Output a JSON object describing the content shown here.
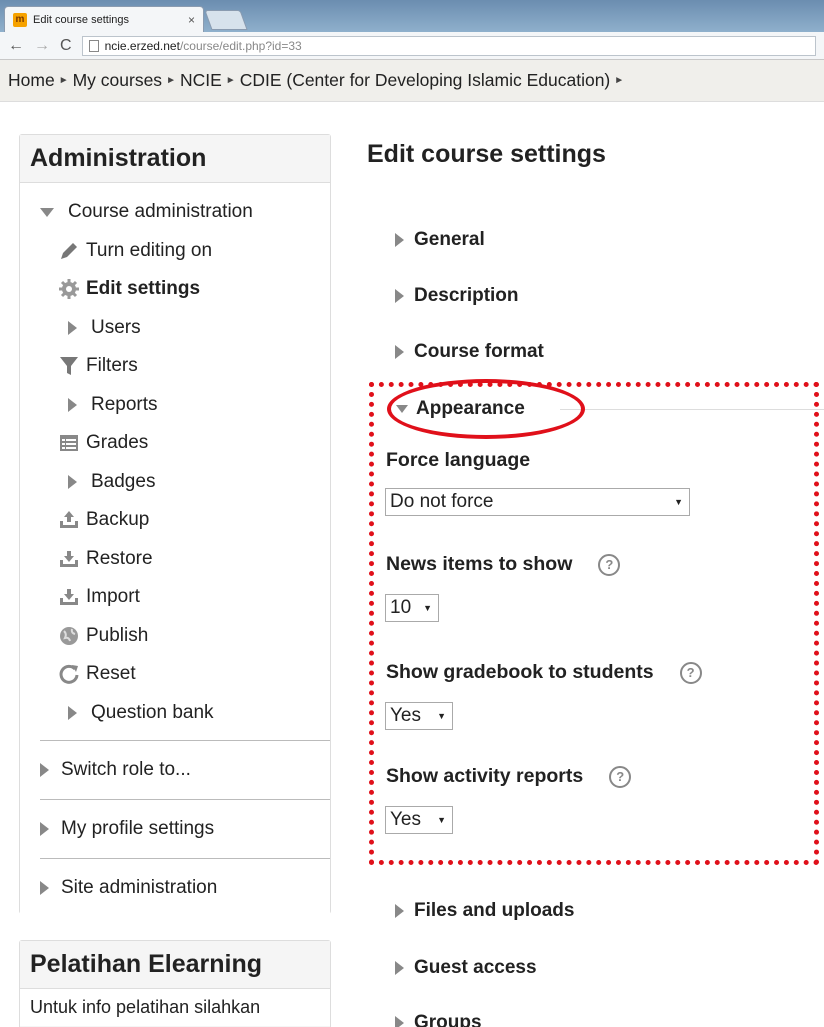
{
  "browser": {
    "tab_title": "Edit course settings",
    "tab_close": "×",
    "favicon": "m",
    "url_host": "ncie.erzed.net",
    "url_path": "/course/edit.php?id=33"
  },
  "breadcrumb": [
    "Home",
    "My courses",
    "NCIE",
    "CDIE (Center for Developing Islamic Education)"
  ],
  "admin_block": {
    "title": "Administration",
    "course_admin": "Course administration",
    "items": [
      {
        "label": "Turn editing on",
        "icon": "pencil-icon"
      },
      {
        "label": "Edit settings",
        "icon": "gear-icon"
      },
      {
        "label": "Users",
        "icon": "expand-icon"
      },
      {
        "label": "Filters",
        "icon": "filter-icon"
      },
      {
        "label": "Reports",
        "icon": "expand-icon"
      },
      {
        "label": "Grades",
        "icon": "grades-icon"
      },
      {
        "label": "Badges",
        "icon": "expand-icon"
      },
      {
        "label": "Backup",
        "icon": "backup-icon"
      },
      {
        "label": "Restore",
        "icon": "restore-icon"
      },
      {
        "label": "Import",
        "icon": "import-icon"
      },
      {
        "label": "Publish",
        "icon": "globe-icon"
      },
      {
        "label": "Reset",
        "icon": "reset-icon"
      },
      {
        "label": "Question bank",
        "icon": "expand-icon"
      }
    ],
    "root_items": [
      "Switch role to...",
      "My profile settings",
      "Site administration"
    ]
  },
  "pelatihan_block": {
    "title": "Pelatihan Elearning",
    "text": "Untuk info pelatihan silahkan"
  },
  "main": {
    "title": "Edit course settings",
    "sections_top": [
      "General",
      "Description",
      "Course format"
    ],
    "appearance": "Appearance",
    "fields": {
      "force_language": {
        "label": "Force language",
        "value": "Do not force"
      },
      "news_items": {
        "label": "News items to show",
        "value": "10"
      },
      "gradebook": {
        "label": "Show gradebook to students",
        "value": "Yes"
      },
      "activity_reports": {
        "label": "Show activity reports",
        "value": "Yes"
      }
    },
    "sections_bottom": [
      "Files and uploads",
      "Guest access",
      "Groups"
    ]
  },
  "colors": {
    "annotation": "#e0101a"
  }
}
